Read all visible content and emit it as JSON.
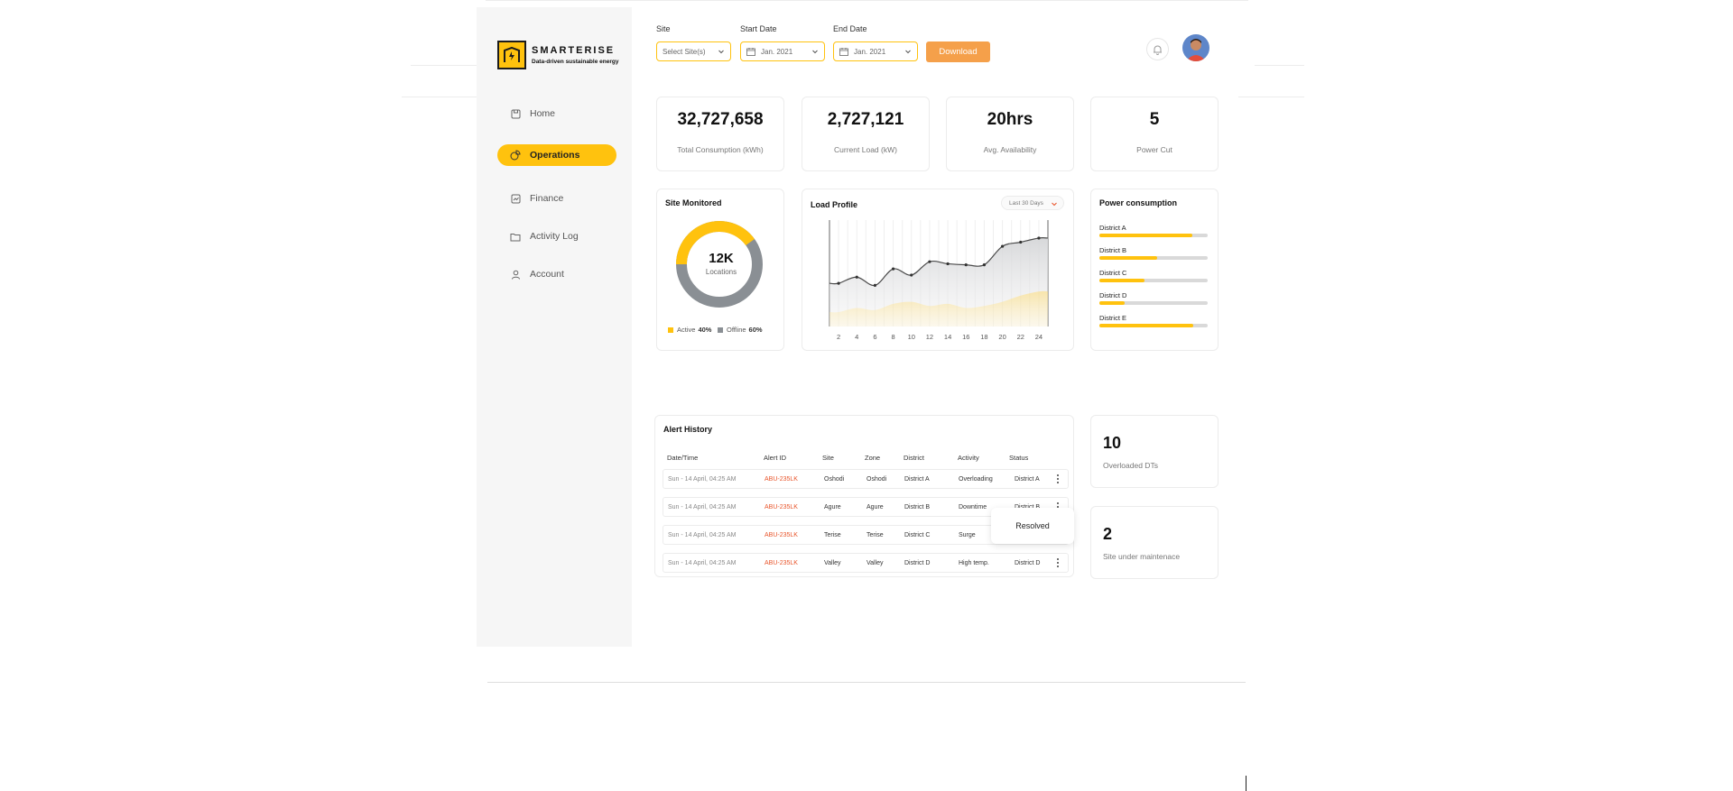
{
  "brand": {
    "name": "SMARTERISE",
    "tagline": "Data-driven sustainable energy",
    "color_primary": "#ffc20e",
    "color_accent": "#f5a04a"
  },
  "nav": {
    "items": [
      {
        "label": "Home",
        "icon": "home-icon",
        "active": false
      },
      {
        "label": "Operations",
        "icon": "operations-icon",
        "active": true
      },
      {
        "label": "Finance",
        "icon": "finance-icon",
        "active": false
      },
      {
        "label": "Activity Log",
        "icon": "folder-icon",
        "active": false
      },
      {
        "label": "Account",
        "icon": "user-icon",
        "active": false
      }
    ]
  },
  "filters": {
    "site": {
      "label": "Site",
      "value": "Select Site(s)"
    },
    "start_date": {
      "label": "Start Date",
      "value": "Jan. 2021"
    },
    "end_date": {
      "label": "End Date",
      "value": "Jan. 2021"
    },
    "download_label": "Download"
  },
  "kpis": [
    {
      "value": "32,727,658",
      "label": "Total Consumption (kWh)"
    },
    {
      "value": "2,727,121",
      "label": "Current Load (kW)"
    },
    {
      "value": "20hrs",
      "label": "Avg. Availability"
    },
    {
      "value": "5",
      "label": "Power Cut"
    }
  ],
  "site_monitored": {
    "title": "Site Monitored",
    "center_value": "12K",
    "center_label": "Locations",
    "legend": [
      {
        "label": "Active",
        "value": "40%",
        "color": "#ffc20e"
      },
      {
        "label": "Offline",
        "value": "60%",
        "color": "#8a8f94"
      }
    ]
  },
  "load_profile": {
    "title": "Load Profile",
    "range": "Last 30 Days"
  },
  "chart_data": {
    "type": "area",
    "x": [
      2,
      4,
      6,
      8,
      10,
      12,
      14,
      16,
      18,
      20,
      22,
      24
    ],
    "ylim": [
      0,
      100
    ],
    "grid": true,
    "series": [
      {
        "values": [
          42,
          48,
          40,
          56,
          50,
          63,
          61,
          60,
          60,
          78,
          82,
          86
        ]
      },
      {
        "values": [
          14,
          18,
          16,
          22,
          24,
          20,
          22,
          18,
          20,
          24,
          30,
          34
        ]
      }
    ]
  },
  "power_consumption": {
    "title": "Power consumption",
    "districts": [
      {
        "name": "District A",
        "fraction": 0.86
      },
      {
        "name": "District B",
        "fraction": 0.53
      },
      {
        "name": "District C",
        "fraction": 0.42
      },
      {
        "name": "District D",
        "fraction": 0.23
      },
      {
        "name": "District E",
        "fraction": 0.87
      }
    ]
  },
  "alert_history": {
    "title": "Alert History",
    "columns": [
      "Date/Time",
      "Alert ID",
      "Site",
      "Zone",
      "District",
      "Activity",
      "Status"
    ],
    "rows": [
      [
        "Sun - 14 April, 04:25 AM",
        "ABU-235LK",
        "Oshodi",
        "Oshodi",
        "District A",
        "Overloading",
        "District A"
      ],
      [
        "Sun - 14 April, 04:25 AM",
        "ABU-235LK",
        "Agure",
        "Agure",
        "District B",
        "Downtime",
        "District B"
      ],
      [
        "Sun - 14 April, 04:25 AM",
        "ABU-235LK",
        "Terise",
        "Terise",
        "District C",
        "Surge",
        ""
      ],
      [
        "Sun - 14 April, 04:25 AM",
        "ABU-235LK",
        "Valley",
        "Valley",
        "District D",
        "High temp.",
        "District D"
      ]
    ],
    "popover_label": "Resolved"
  },
  "stats": [
    {
      "value": "10",
      "label": "Overloaded DTs"
    },
    {
      "value": "2",
      "label": "Site under maintenace"
    }
  ]
}
